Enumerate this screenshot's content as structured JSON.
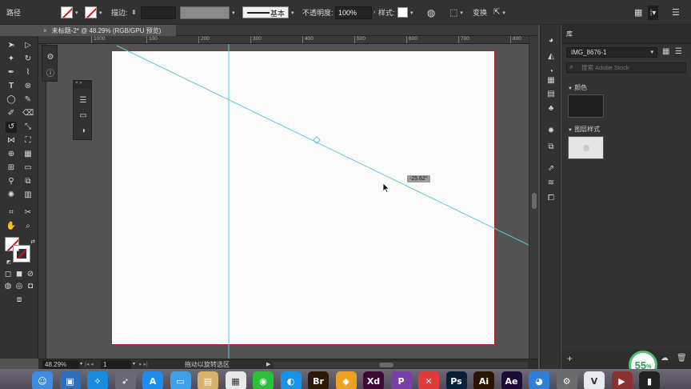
{
  "control_bar": {
    "object_type": "路径",
    "stroke_label": "描边:",
    "stroke_style": "基本",
    "opacity_label": "不透明度:",
    "opacity_value": "100%",
    "style_label": "样式:",
    "transform_label": "变换"
  },
  "document_tab": {
    "close_glyph": "×",
    "title": "未标题-2* @ 48.29% (RGB/GPU 预览)"
  },
  "ruler": {
    "ticks": [
      "1000",
      "100",
      "200",
      "300",
      "400",
      "500",
      "600",
      "700",
      "800"
    ]
  },
  "canvas": {
    "rotate_angle": "-25.62°"
  },
  "status_bar": {
    "zoom": "48.29%",
    "artboard_number": "1",
    "hint": "拖动以旋转选区"
  },
  "libraries_panel": {
    "tab_title": "库",
    "library_name": "IMG_8676-1",
    "search_placeholder": "搜索 Adobe Stock",
    "section_colors": "颜色",
    "section_layer_styles": "图层样式"
  },
  "usage_badge": {
    "value": "55",
    "unit": "%"
  },
  "colors": {
    "chrome_dark": "#323232",
    "canvas_bg": "#535353",
    "artboard_border": "#a02828",
    "guide_cyan": "#5ccdd8"
  },
  "dock": {
    "apps": [
      {
        "name": "finder-icon",
        "glyph": "☺",
        "bg": "#3e8de3"
      },
      {
        "name": "preview-icon",
        "glyph": "▣",
        "bg": "#2e6fb8"
      },
      {
        "name": "safari-icon",
        "glyph": "✧",
        "bg": "#1a8ce0"
      },
      {
        "name": "launchpad-icon",
        "glyph": "➶",
        "bg": "#6a6a76"
      },
      {
        "name": "app-store-icon",
        "glyph": "A",
        "bg": "#1e8bef"
      },
      {
        "name": "keynote-icon",
        "glyph": "▭",
        "bg": "#3da0e8"
      },
      {
        "name": "photo-viewer-icon",
        "glyph": "▤",
        "bg": "#d9b26a"
      },
      {
        "name": "calendar-icon",
        "glyph": "▦",
        "bg": "#e8e8e8"
      },
      {
        "name": "wechat-icon",
        "glyph": "◉",
        "bg": "#2bbf3a"
      },
      {
        "name": "qq-browser-icon",
        "glyph": "◐",
        "bg": "#1993e6"
      },
      {
        "name": "bridge-icon",
        "glyph": "Br",
        "bg": "#2c1a05"
      },
      {
        "name": "sketch-icon",
        "glyph": "◆",
        "bg": "#f0a020"
      },
      {
        "name": "xd-icon",
        "glyph": "Xd",
        "bg": "#3e0a33"
      },
      {
        "name": "pdf-expert-icon",
        "glyph": "P",
        "bg": "#7b3fa8"
      },
      {
        "name": "xmind-icon",
        "glyph": "✕",
        "bg": "#e23a3a"
      },
      {
        "name": "photoshop-icon",
        "glyph": "Ps",
        "bg": "#0a1f3a"
      },
      {
        "name": "illustrator-icon",
        "glyph": "Ai",
        "bg": "#2c1500"
      },
      {
        "name": "after-effects-icon",
        "glyph": "Ae",
        "bg": "#1d0a36"
      },
      {
        "name": "qq-icon",
        "glyph": "◕",
        "bg": "#2f7fd8"
      },
      {
        "name": "settings-icon",
        "glyph": "⚙",
        "bg": "#6c6c6c"
      },
      {
        "name": "video-app-icon",
        "glyph": "V",
        "bg": "#e8e8f0"
      },
      {
        "name": "movie-icon",
        "glyph": "▶",
        "bg": "#8a3030"
      },
      {
        "name": "terminal-icon",
        "glyph": "▮",
        "bg": "#222"
      }
    ]
  }
}
